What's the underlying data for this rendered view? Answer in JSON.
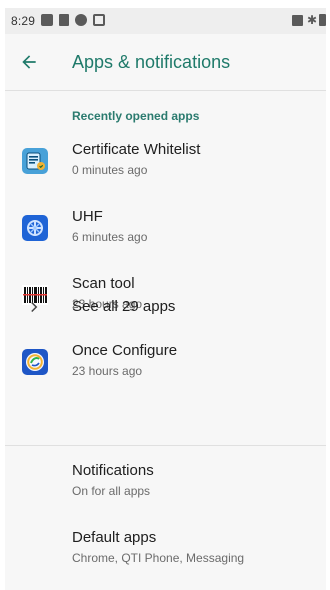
{
  "status_bar": {
    "time": "8:29",
    "left_icons": [
      "picture-icon",
      "sim-icon",
      "bug-icon",
      "notification-box-icon"
    ],
    "right_icons": [
      "no-signal-icon",
      "bluetooth-icon",
      "battery-icon"
    ]
  },
  "app_bar": {
    "title": "Apps & notifications"
  },
  "recent": {
    "section_title": "Recently opened apps",
    "apps": [
      {
        "name": "Certificate Whitelist",
        "subtitle": "0 minutes ago",
        "icon": "certificate-icon"
      },
      {
        "name": "UHF",
        "subtitle": "6 minutes ago",
        "icon": "uhf-icon"
      },
      {
        "name": "Scan tool",
        "subtitle": "23 hours ago",
        "icon": "barcode-icon"
      },
      {
        "name": "Once Configure",
        "subtitle": "23 hours ago",
        "icon": "once-configure-icon"
      }
    ],
    "see_all": "See all 29 apps"
  },
  "settings": [
    {
      "title": "Notifications",
      "subtitle": "On for all apps"
    },
    {
      "title": "Default apps",
      "subtitle": "Chrome, QTI Phone, Messaging"
    }
  ],
  "colors": {
    "accent": "#1f7a6a",
    "background": "#f7f7f7"
  }
}
